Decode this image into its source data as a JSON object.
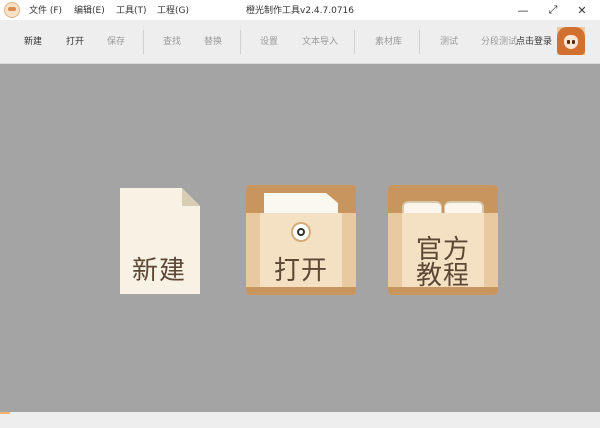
{
  "window": {
    "title": "橙光制作工具v2.4.7.0716",
    "controls": {
      "minimize": "—",
      "maximize": "⤢",
      "close": "✕"
    }
  },
  "menu": [
    {
      "label": "文件 (F)"
    },
    {
      "label": "编辑(E)"
    },
    {
      "label": "工具(T)"
    },
    {
      "label": "工程(G)"
    }
  ],
  "toolbar": {
    "new": "新建",
    "open": "打开",
    "save": "保存",
    "find": "查找",
    "replace": "替换",
    "settings": "设置",
    "text_import": "文本导入",
    "assets": "素材库",
    "test": "测试",
    "segment_test": "分段测试",
    "login": "点击登录"
  },
  "main": {
    "new_label": "新建",
    "open_label": "打开",
    "tutorial_line1": "官方",
    "tutorial_line2": "教程"
  },
  "colors": {
    "background": "#a4a4a4",
    "toolbar": "#eeeeee",
    "box": "#e9c99f",
    "box_dark": "#c9955e",
    "text_brown": "#5d4836"
  }
}
